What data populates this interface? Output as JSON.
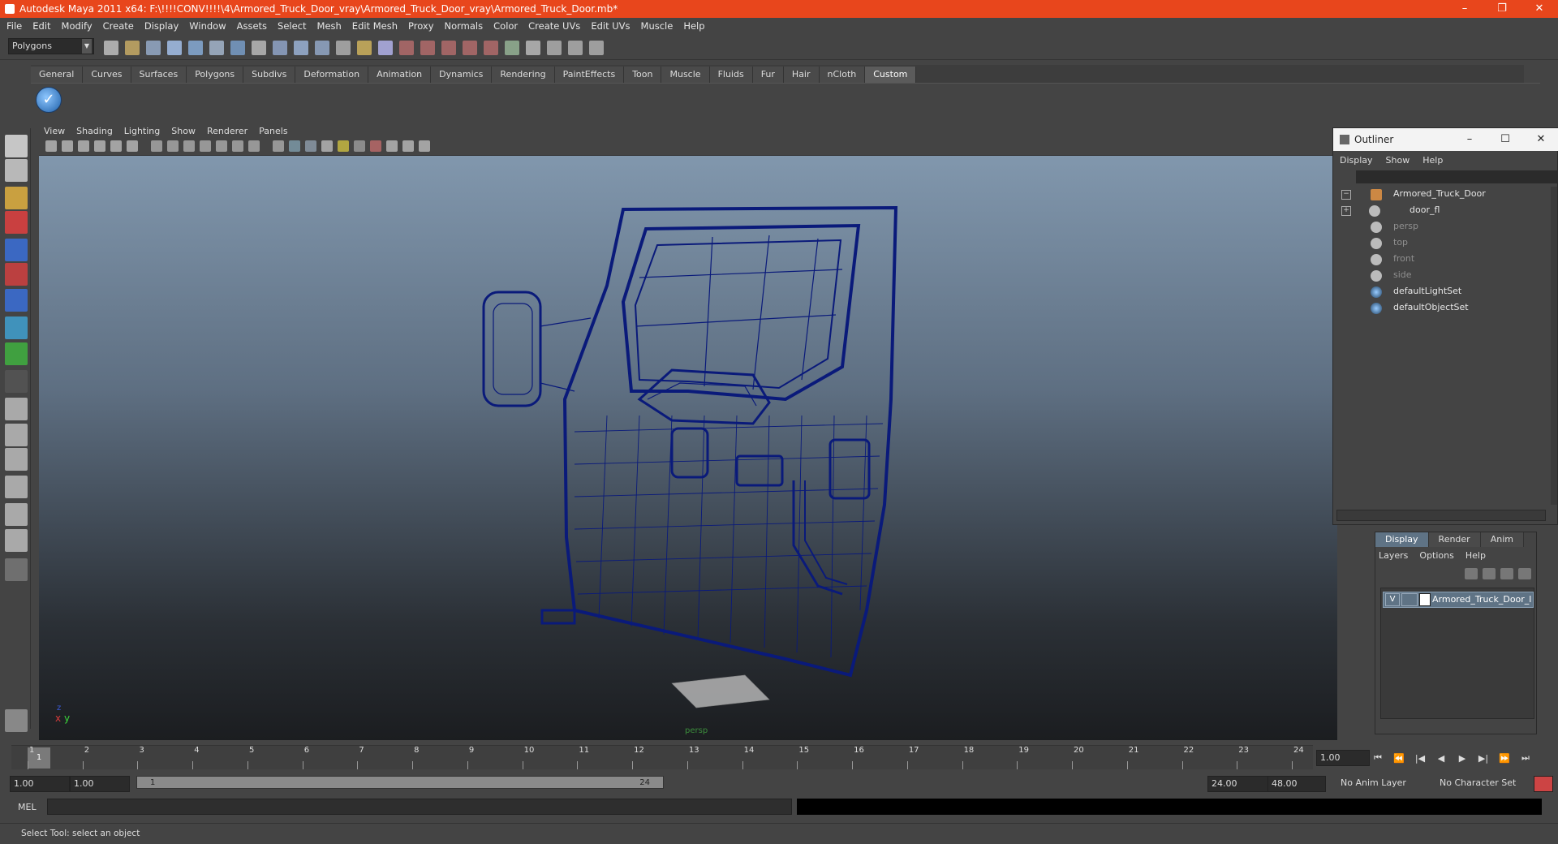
{
  "window": {
    "title": "Autodesk Maya 2011 x64: F:\\!!!!CONV!!!!\\4\\Armored_Truck_Door_vray\\Armored_Truck_Door_vray\\Armored_Truck_Door.mb*",
    "minimize": "–",
    "maximize": "❐",
    "close": "✕"
  },
  "menubar": [
    "File",
    "Edit",
    "Modify",
    "Create",
    "Display",
    "Window",
    "Assets",
    "Select",
    "Mesh",
    "Edit Mesh",
    "Proxy",
    "Normals",
    "Color",
    "Create UVs",
    "Edit UVs",
    "Muscle",
    "Help"
  ],
  "status_line": {
    "menu_set": "Polygons"
  },
  "shelf": {
    "tabs": [
      "General",
      "Curves",
      "Surfaces",
      "Polygons",
      "Subdivs",
      "Deformation",
      "Animation",
      "Dynamics",
      "Rendering",
      "PaintEffects",
      "Toon",
      "Muscle",
      "Fluids",
      "Fur",
      "Hair",
      "nCloth",
      "Custom"
    ],
    "active_tab": "Custom",
    "icon": "✓"
  },
  "viewport": {
    "menu": [
      "View",
      "Shading",
      "Lighting",
      "Show",
      "Renderer",
      "Panels"
    ],
    "camera": "persp",
    "axis_x": "x",
    "axis_y": "y",
    "axis_z": "z"
  },
  "outliner": {
    "title": "Outliner",
    "minimize": "–",
    "maximize": "☐",
    "close": "✕",
    "menu": [
      "Display",
      "Show",
      "Help"
    ],
    "items": [
      {
        "name": "Armored_Truck_Door",
        "expand": "−",
        "dim": false
      },
      {
        "name": "door_fl",
        "expand": "+",
        "dim": false
      },
      {
        "name": "persp",
        "expand": "",
        "dim": true
      },
      {
        "name": "top",
        "expand": "",
        "dim": true
      },
      {
        "name": "front",
        "expand": "",
        "dim": true
      },
      {
        "name": "side",
        "expand": "",
        "dim": true
      },
      {
        "name": "defaultLightSet",
        "expand": "",
        "dim": false
      },
      {
        "name": "defaultObjectSet",
        "expand": "",
        "dim": false
      }
    ]
  },
  "layer_editor": {
    "tabs": [
      "Display",
      "Render",
      "Anim"
    ],
    "active_tab": "Display",
    "menu": [
      "Layers",
      "Options",
      "Help"
    ],
    "layer_visible": "V",
    "layer_name": "Armored_Truck_Door_lay"
  },
  "time_slider": {
    "ticks": [
      "1",
      "2",
      "3",
      "4",
      "5",
      "6",
      "7",
      "8",
      "9",
      "10",
      "11",
      "12",
      "13",
      "14",
      "15",
      "16",
      "17",
      "18",
      "19",
      "20",
      "21",
      "22",
      "23",
      "24"
    ],
    "current_frame": "1",
    "current_time_field": "1.00"
  },
  "range": {
    "start_time": "1.00",
    "playback_start": "1.00",
    "range_start_label": "1",
    "range_end_label": "24",
    "playback_end": "24.00",
    "end_time": "48.00",
    "anim_layer": "No Anim Layer",
    "character_set": "No Character Set"
  },
  "command_line": {
    "label": "MEL"
  },
  "help_line": {
    "text": "Select Tool: select an object"
  },
  "colors": {
    "title_bar": "#e8461c",
    "wire": "#0a1a7a",
    "layer_row": "#5f7385"
  }
}
